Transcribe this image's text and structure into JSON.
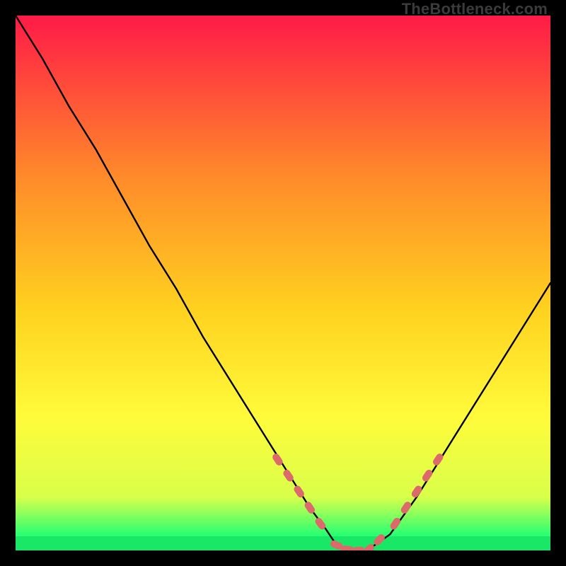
{
  "watermark": {
    "text": "TheBottleneck.com"
  },
  "chart_data": {
    "type": "line",
    "title": "",
    "xlabel": "",
    "ylabel": "",
    "xlim": [
      0,
      100
    ],
    "ylim": [
      0,
      100
    ],
    "grid": false,
    "legend": false,
    "colors": {
      "gradient_top": "#ff1a47",
      "gradient_mid_upper": "#ff8a2a",
      "gradient_mid": "#ffd21f",
      "gradient_yellow": "#fffb3a",
      "gradient_lowmid": "#d9ff4a",
      "gradient_band": "#2cff71",
      "curve": "#000000",
      "markers": "#dd6a6a"
    },
    "series": [
      {
        "name": "bottleneck-curve",
        "x": [
          0,
          5,
          10,
          15,
          20,
          25,
          30,
          35,
          40,
          45,
          50,
          55,
          58,
          60,
          62,
          64,
          66,
          70,
          75,
          80,
          85,
          90,
          95,
          100
        ],
        "y": [
          100,
          92,
          83,
          75,
          66,
          57,
          49,
          40,
          32,
          24,
          16,
          8,
          4,
          1,
          0.2,
          0,
          0.2,
          3,
          10,
          18,
          26,
          34,
          42,
          50
        ]
      }
    ],
    "markers": {
      "name": "highlight-range",
      "points": [
        {
          "x": 49,
          "y": 17
        },
        {
          "x": 51,
          "y": 14
        },
        {
          "x": 53,
          "y": 11
        },
        {
          "x": 55,
          "y": 8
        },
        {
          "x": 57,
          "y": 5
        },
        {
          "x": 60,
          "y": 1
        },
        {
          "x": 62,
          "y": 0.2
        },
        {
          "x": 64,
          "y": 0
        },
        {
          "x": 66,
          "y": 0.2
        },
        {
          "x": 68,
          "y": 2
        },
        {
          "x": 71,
          "y": 5
        },
        {
          "x": 73,
          "y": 8
        },
        {
          "x": 75,
          "y": 11
        },
        {
          "x": 77,
          "y": 14
        },
        {
          "x": 79,
          "y": 17
        }
      ]
    }
  }
}
